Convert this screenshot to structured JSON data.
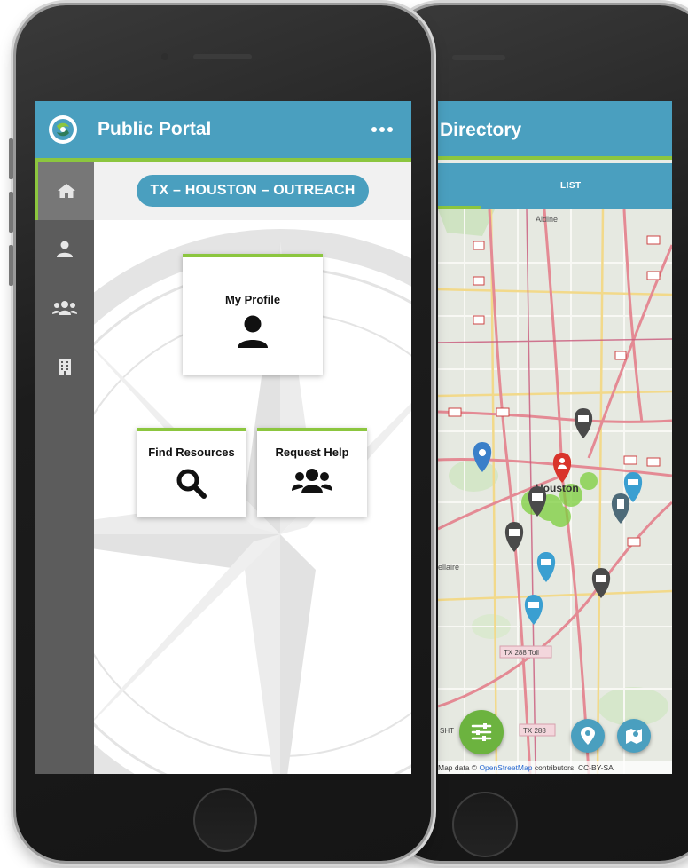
{
  "front_app": {
    "title": "Public Portal",
    "location_label": "TX – HOUSTON – OUTREACH",
    "nav": [
      {
        "icon": "home-icon",
        "active": true
      },
      {
        "icon": "user-icon",
        "active": false
      },
      {
        "icon": "users-icon",
        "active": false
      },
      {
        "icon": "building-icon",
        "active": false
      }
    ],
    "tiles": {
      "my_profile": "My Profile",
      "find_resources": "Find Resources",
      "request_help": "Request Help"
    }
  },
  "back_app": {
    "title": "Directory",
    "tab_list": "LIST",
    "map_labels": {
      "aldine": "Aldine",
      "houston": "Houston",
      "bellaire": "ellaire",
      "tx288_toll": "TX 288 Toll",
      "tx288": "TX 288",
      "sht": "SHT"
    },
    "attribution": {
      "prefix": "Map data © ",
      "link": "OpenStreetMap",
      "suffix": " contributors, CC-BY-SA"
    }
  },
  "colors": {
    "header": "#4a9fbf",
    "accent": "#8cc63f",
    "sidebar": "#5c5c5c",
    "pin_dark": "#4a4a4a",
    "pin_blue": "#3a9fd1",
    "pin_red": "#d9342b",
    "cluster": "#7ccf3c"
  }
}
